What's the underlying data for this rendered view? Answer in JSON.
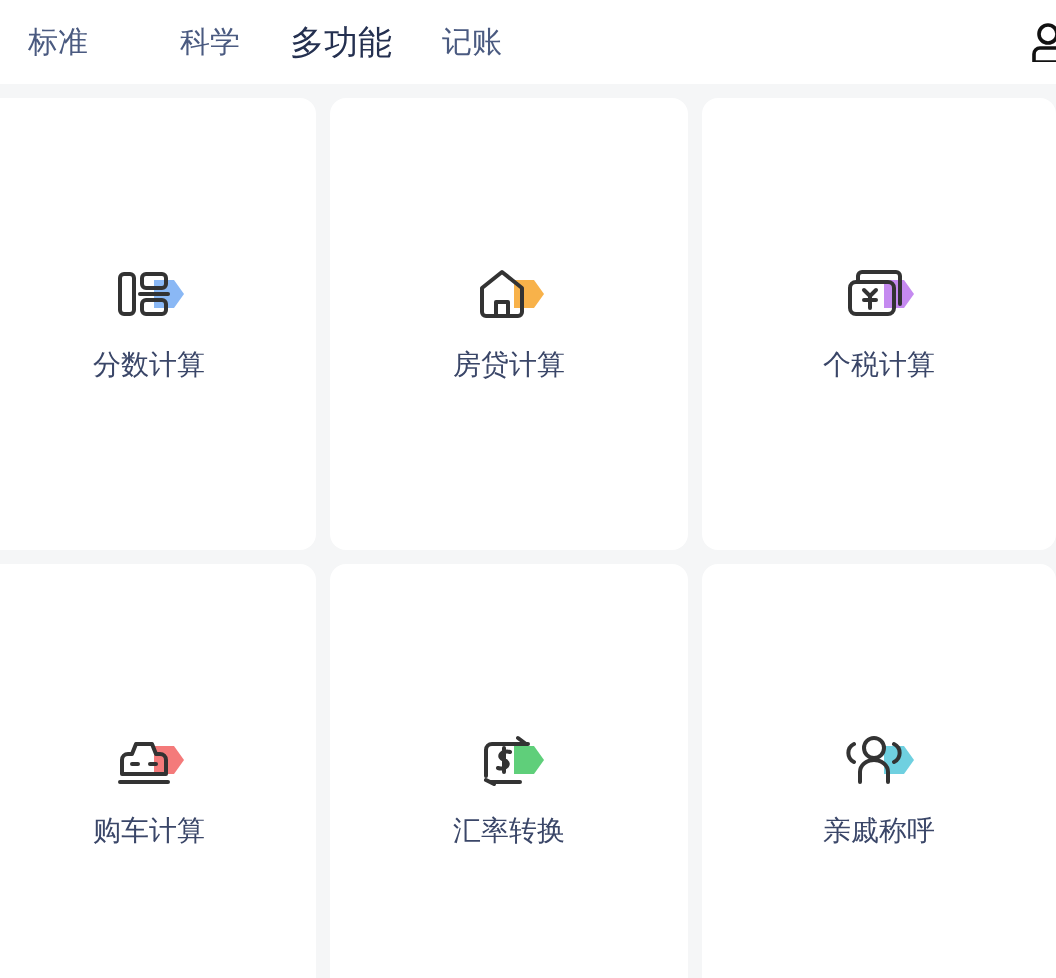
{
  "tabs": [
    {
      "label": "标准",
      "selected": false
    },
    {
      "label": "科学",
      "selected": false
    },
    {
      "label": "多功能",
      "selected": true
    },
    {
      "label": "记账",
      "selected": false
    }
  ],
  "tools": [
    {
      "label": "分数计算",
      "kind": "fraction",
      "color": "#8ab8f5"
    },
    {
      "label": "房贷计算",
      "kind": "house",
      "color": "#f8b24a"
    },
    {
      "label": "个税计算",
      "kind": "tax",
      "color": "#c58af0"
    },
    {
      "label": "购车计算",
      "kind": "car",
      "color": "#f47a7a"
    },
    {
      "label": "汇率转换",
      "kind": "exchange",
      "color": "#5fcf7a"
    },
    {
      "label": "亲戚称呼",
      "kind": "relatives",
      "color": "#6fd0e0"
    }
  ]
}
